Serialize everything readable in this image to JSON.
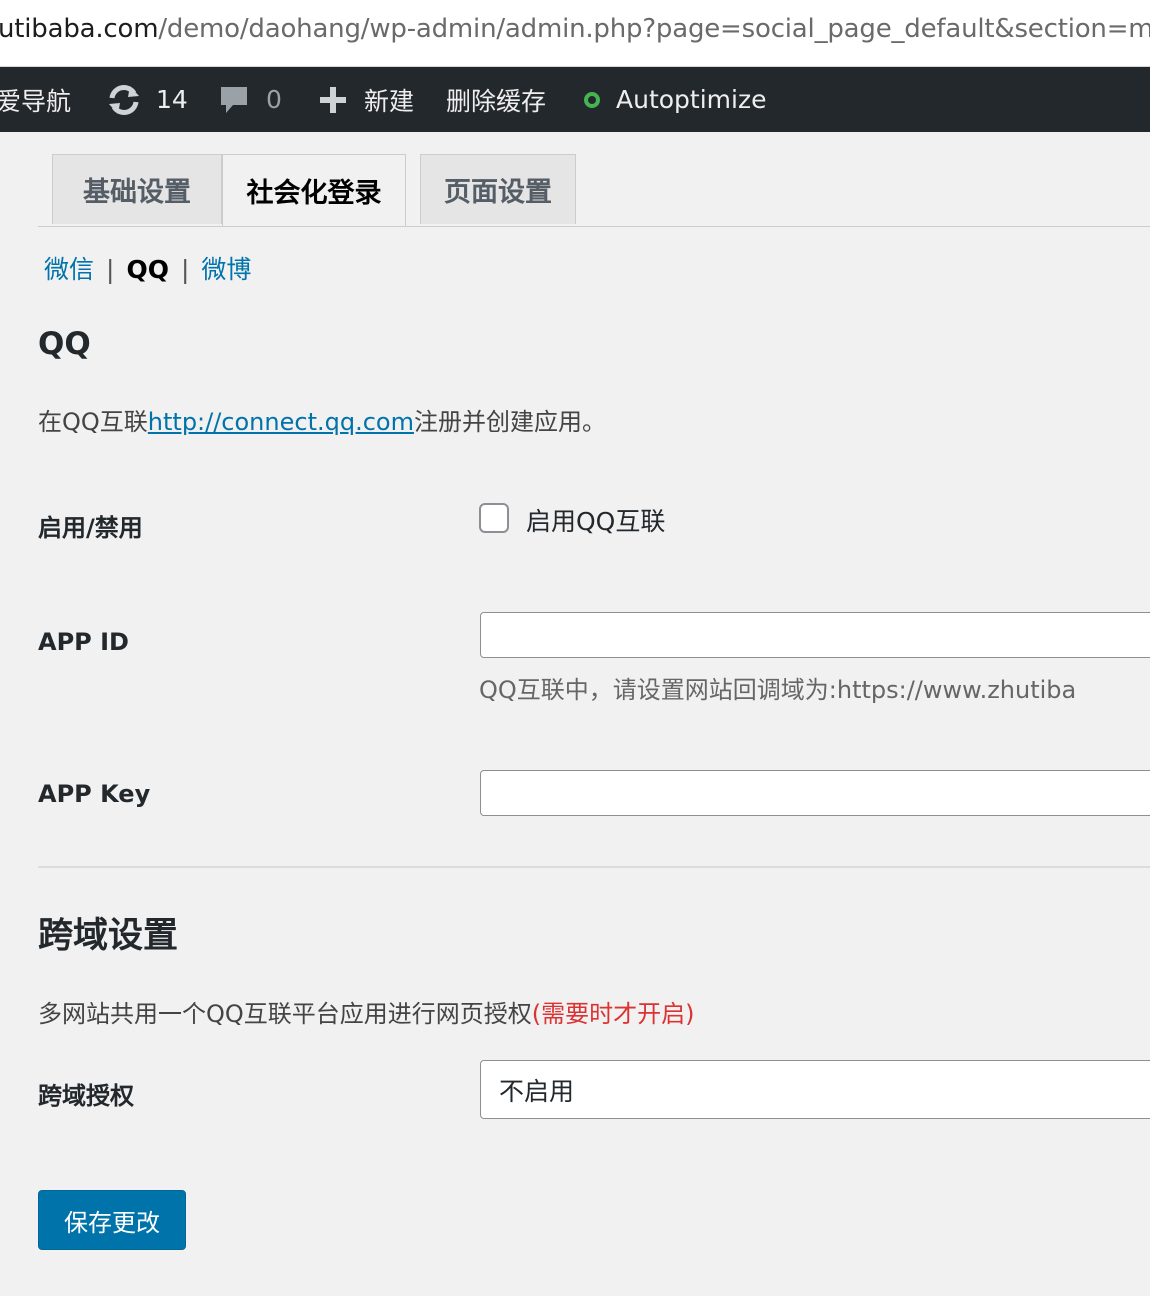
{
  "browser": {
    "url_host": "utibaba.com",
    "url_path": "/demo/daohang/wp-admin/admin.php?page=social_page_default&section=me"
  },
  "adminbar": {
    "site_name": "爱导航",
    "updates_count": "14",
    "comments_count": "0",
    "new_label": "新建",
    "clear_cache_label": "删除缓存",
    "autoptimize_label": "Autoptimize",
    "colors": {
      "bar": "#23282d",
      "status_green": "#46b450"
    }
  },
  "tabs": [
    {
      "label": "基础设置",
      "active": false
    },
    {
      "label": "社会化登录",
      "active": true
    },
    {
      "label": "页面设置",
      "active": false
    }
  ],
  "subnav": {
    "items": [
      "微信",
      "QQ",
      "微博"
    ],
    "current": "QQ",
    "separator": "|"
  },
  "qq_section": {
    "title": "QQ",
    "desc_prefix": "在QQ互联",
    "desc_link": "http://connect.qq.com",
    "desc_suffix": "注册并创建应用。"
  },
  "fields": {
    "enable": {
      "label": "启用/禁用",
      "checkbox_label": "启用QQ互联",
      "checked": false
    },
    "app_id": {
      "label": "APP ID",
      "value": "",
      "help": "QQ互联中，请设置网站回调域为:https://www.zhutiba"
    },
    "app_key": {
      "label": "APP Key",
      "value": ""
    }
  },
  "cross_section": {
    "title": "跨域设置",
    "desc": "多网站共用一个QQ互联平台应用进行网页授权",
    "desc_note": "(需要时才开启)",
    "field_label": "跨域授权",
    "select_value": "不启用"
  },
  "save_button": "保存更改",
  "colors": {
    "link": "#0073aa",
    "primary_button": "#0073aa",
    "warning": "#dc3232",
    "page_bg": "#f1f1f1"
  }
}
